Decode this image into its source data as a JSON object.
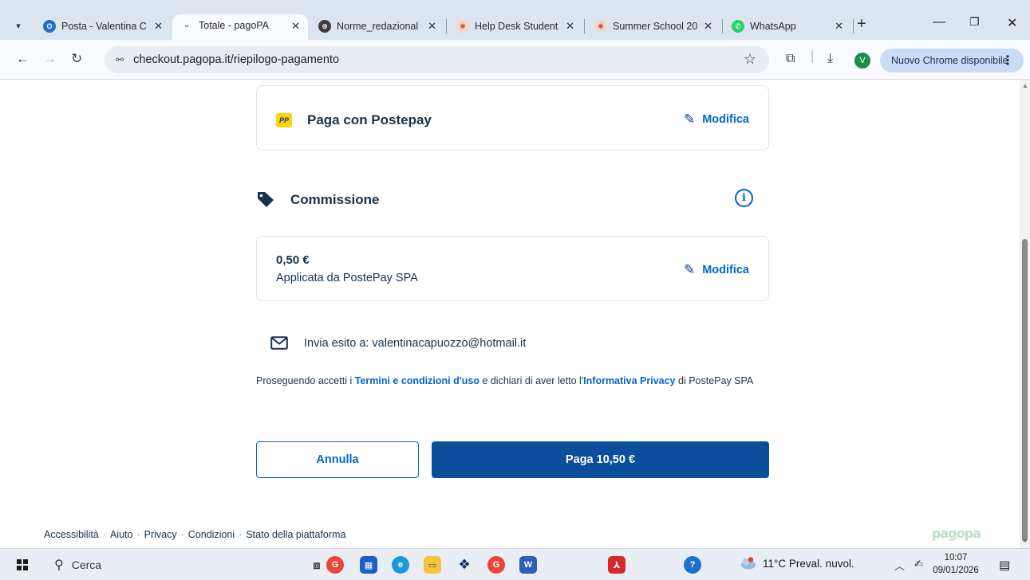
{
  "browser": {
    "tabs": [
      {
        "title": "Posta - Valentina C",
        "active": false,
        "favicon_color": "#1f6fcf"
      },
      {
        "title": "Totale - pagoPA",
        "active": true,
        "favicon_color": "#0073e6"
      },
      {
        "title": "Norme_redazional",
        "active": false,
        "favicon_color": "#3c3c3c"
      },
      {
        "title": "Help Desk Student",
        "active": false,
        "favicon_color": "#d9694a"
      },
      {
        "title": "Summer School 20",
        "active": false,
        "favicon_color": "#d9694a"
      },
      {
        "title": "WhatsApp",
        "active": false,
        "favicon_color": "#25d366"
      }
    ],
    "url": "checkout.pagopa.it/riepilogo-pagamento",
    "profile_initial": "V",
    "update_label": "Nuovo Chrome disponibile"
  },
  "payment_method": {
    "logo_text": "PP",
    "title": "Paga con Postepay",
    "edit_label": "Modifica"
  },
  "fee": {
    "title": "Commissione",
    "amount": "0,50 €",
    "applied_by": "Applicata da PostePay SPA",
    "edit_label": "Modifica"
  },
  "email": {
    "text": "Invia esito a: valentinacapuozzo@hotmail.it"
  },
  "terms": {
    "part1": "Proseguendo accetti i ",
    "link1": "Termini e condizioni d'uso",
    "part2": " e dichiari di aver letto l'",
    "link2": "Informativa Privacy",
    "part3": " di PostePay SPA"
  },
  "actions": {
    "cancel_label": "Annulla",
    "pay_label": "Paga 10,50 €"
  },
  "footer": {
    "links": [
      "Accessibilità",
      "Aiuto",
      "Privacy",
      "Condizioni",
      "Stato della piattaforma"
    ],
    "logo_text": "pagopa"
  },
  "taskbar": {
    "search_placeholder": "Cerca",
    "weather": "11°C  Preval. nuvol.",
    "time": "10:07",
    "date": "09/01/2026"
  },
  "colors": {
    "accent": "#0066cc",
    "pay_button": "#0b4f9c",
    "text": "#17324d"
  }
}
